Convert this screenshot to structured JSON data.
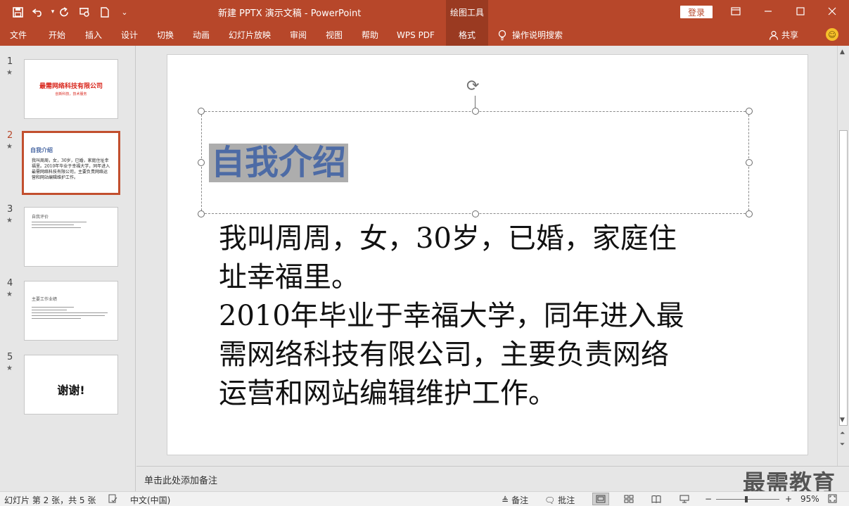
{
  "titlebar": {
    "doc_title": "新建 PPTX 演示文稿 - PowerPoint",
    "context_tab": "绘图工具",
    "login": "登录",
    "quick_access": [
      {
        "name": "save-icon",
        "glyph": "💾"
      },
      {
        "name": "undo-icon",
        "glyph": "↶"
      },
      {
        "name": "redo-icon",
        "glyph": "↻"
      },
      {
        "name": "present-icon",
        "glyph": "⊡"
      },
      {
        "name": "new-file-icon",
        "glyph": "🗋"
      },
      {
        "name": "customize-icon",
        "glyph": "⌄"
      }
    ],
    "window_controls": [
      {
        "name": "ribbon-display-icon",
        "glyph": "⊟"
      },
      {
        "name": "minimize-icon",
        "glyph": "—"
      },
      {
        "name": "maximize-icon",
        "glyph": "☐"
      },
      {
        "name": "close-icon",
        "glyph": "✕"
      }
    ]
  },
  "ribbon": {
    "tabs": [
      {
        "label": "文件",
        "active": false
      },
      {
        "label": "开始",
        "active": false
      },
      {
        "label": "插入",
        "active": false
      },
      {
        "label": "设计",
        "active": false
      },
      {
        "label": "切换",
        "active": false
      },
      {
        "label": "动画",
        "active": false
      },
      {
        "label": "幻灯片放映",
        "active": false
      },
      {
        "label": "审阅",
        "active": false
      },
      {
        "label": "视图",
        "active": false
      },
      {
        "label": "帮助",
        "active": false
      },
      {
        "label": "WPS PDF",
        "active": false
      },
      {
        "label": "格式",
        "active": true
      }
    ],
    "search_label": "操作说明搜索",
    "share_label": "共享"
  },
  "thumbnails": [
    {
      "number": "1",
      "active": false,
      "title": "最需网络科技有限公司",
      "subtitle": "创新科技，技术服务"
    },
    {
      "number": "2",
      "active": true,
      "title": "自我介绍",
      "body": "我叫周周，女，30岁，已婚，家庭住址幸福里。2010年毕业于幸福大学，同年进入最需网络科技有限公司，主要负责网络运营和网站编辑维护工作。"
    },
    {
      "number": "3",
      "active": false,
      "title": "自我评价",
      "body": ""
    },
    {
      "number": "4",
      "active": false,
      "title": "主要工作业绩",
      "body": ""
    },
    {
      "number": "5",
      "active": false,
      "title": "谢谢!"
    }
  ],
  "slide": {
    "title": "自我介绍",
    "body_lines": [
      "我叫周周，女，30岁，已婚，家庭住",
      "址幸福里。",
      "2010年毕业于幸福大学，同年进入最",
      "需网络科技有限公司，主要负责网络",
      "运营和网站编辑维护工作。"
    ]
  },
  "notes": {
    "placeholder": "单击此处添加备注",
    "watermark": "最需教育"
  },
  "statusbar": {
    "slide_info": "幻灯片 第 2 张，共 5 张",
    "language": "中文(中国)",
    "notes_label": "备注",
    "comments_label": "批注",
    "zoom": "95%",
    "zoom_fraction": 0.475
  },
  "colors": {
    "accent": "#b7472a",
    "accent_dark": "#9a3a21",
    "title_text": "#4d6ba5",
    "selection_highlight": "#adadad"
  }
}
